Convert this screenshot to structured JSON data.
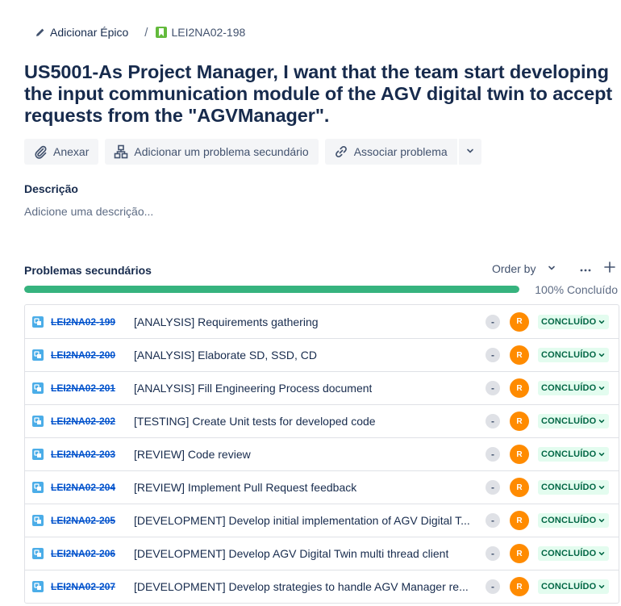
{
  "breadcrumb": {
    "epic_label": "Adicionar Épico",
    "separator": "/",
    "issue_key": "LEI2NA02-198"
  },
  "issue": {
    "title": "US5001-As Project Manager, I want that the team start developing the input communication module of the AGV digital twin to accept requests from the \"AGVManager\"."
  },
  "actions": {
    "attach": "Anexar",
    "add_child": "Adicionar um problema secundário",
    "link_issue": "Associar problema"
  },
  "description": {
    "label": "Descrição",
    "placeholder": "Adicione uma descrição..."
  },
  "child_issues": {
    "title": "Problemas secundários",
    "order_by": "Order by",
    "progress_percent": 100,
    "progress_label": "100% Concluído",
    "items": [
      {
        "key": "LEI2NA02-199",
        "summary": "[ANALYSIS] Requirements gathering",
        "priority": "-",
        "assignee": "R",
        "status": "CONCLUÍDO"
      },
      {
        "key": "LEI2NA02-200",
        "summary": "[ANALYSIS] Elaborate SD, SSD, CD",
        "priority": "-",
        "assignee": "R",
        "status": "CONCLUÍDO"
      },
      {
        "key": "LEI2NA02-201",
        "summary": "[ANALYSIS] Fill Engineering Process document",
        "priority": "-",
        "assignee": "R",
        "status": "CONCLUÍDO"
      },
      {
        "key": "LEI2NA02-202",
        "summary": "[TESTING] Create Unit tests for developed code",
        "priority": "-",
        "assignee": "R",
        "status": "CONCLUÍDO"
      },
      {
        "key": "LEI2NA02-203",
        "summary": "[REVIEW] Code review",
        "priority": "-",
        "assignee": "R",
        "status": "CONCLUÍDO"
      },
      {
        "key": "LEI2NA02-204",
        "summary": "[REVIEW] Implement Pull Request feedback",
        "priority": "-",
        "assignee": "R",
        "status": "CONCLUÍDO"
      },
      {
        "key": "LEI2NA02-205",
        "summary": "[DEVELOPMENT] Develop initial implementation of AGV Digital T...",
        "priority": "-",
        "assignee": "R",
        "status": "CONCLUÍDO"
      },
      {
        "key": "LEI2NA02-206",
        "summary": "[DEVELOPMENT] Develop AGV Digital Twin multi thread client",
        "priority": "-",
        "assignee": "R",
        "status": "CONCLUÍDO"
      },
      {
        "key": "LEI2NA02-207",
        "summary": "[DEVELOPMENT] Develop strategies to handle AGV Manager re...",
        "priority": "-",
        "assignee": "R",
        "status": "CONCLUÍDO"
      }
    ]
  },
  "colors": {
    "progress": "#36b37e",
    "avatar": "#ff8b00",
    "status_bg": "#e3fcef",
    "status_text": "#006644",
    "subtask_icon": "#4bade8",
    "story_icon": "#63ba3c",
    "link": "#0052cc"
  }
}
